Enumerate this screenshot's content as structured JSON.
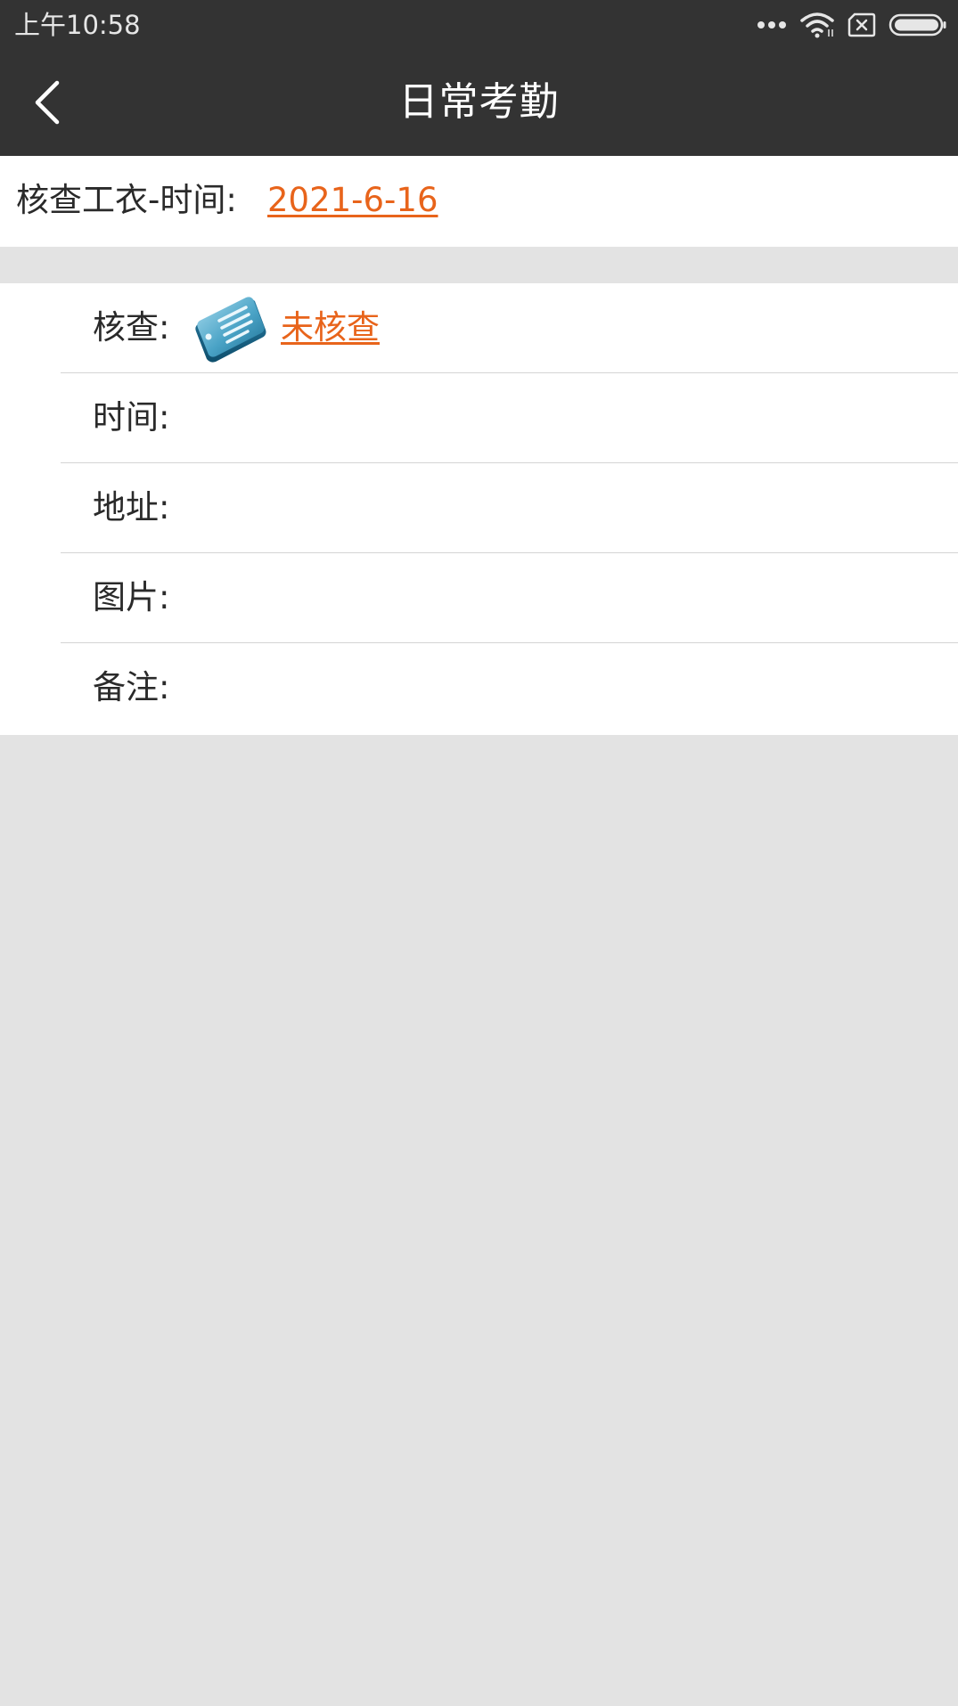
{
  "status_bar": {
    "time": "上午10:58",
    "icons": [
      "more-dots-icon",
      "wifi-icon",
      "sim-error-icon",
      "battery-icon"
    ]
  },
  "toolbar": {
    "title": "日常考勤",
    "back_icon": "chevron-left-icon"
  },
  "date_row": {
    "label": "核查工衣-时间:",
    "value": "2021-6-16"
  },
  "details": {
    "check": {
      "label": "核查:",
      "icon": "document-icon",
      "status": "未核查"
    },
    "time": {
      "label": "时间:"
    },
    "address": {
      "label": "地址:"
    },
    "picture": {
      "label": "图片:"
    },
    "note": {
      "label": "备注:"
    }
  },
  "colors": {
    "bar_bg": "#333333",
    "accent": "#e8641b",
    "page_bg": "#e3e3e3",
    "divider": "#d4d4d4"
  }
}
